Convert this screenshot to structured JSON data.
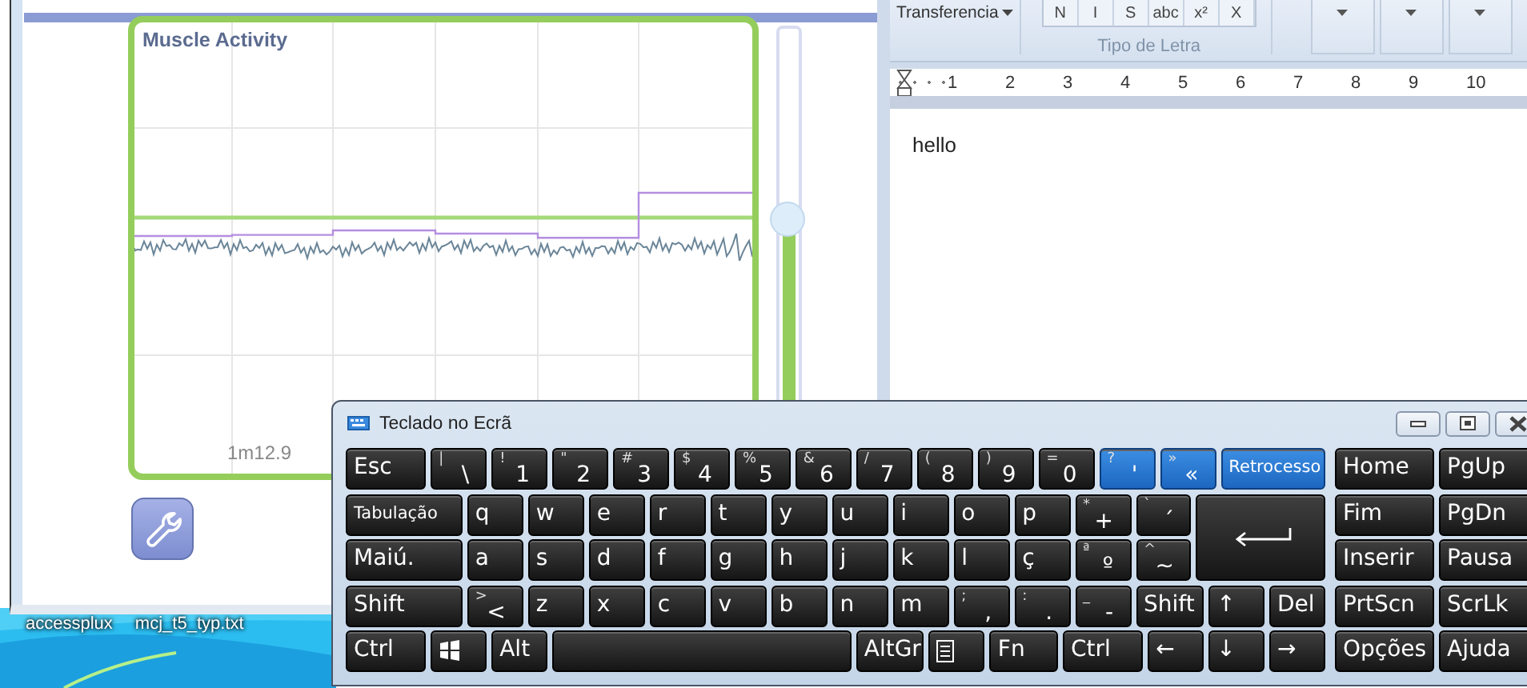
{
  "app_window": {
    "chart": {
      "title": "Muscle Activity",
      "time_label": "1m12.9"
    },
    "slider": {
      "level": 0.6
    }
  },
  "desktop_icons": [
    {
      "label": "accessplux"
    },
    {
      "label": "mcj_t5_typ.txt"
    }
  ],
  "word_window": {
    "clipboard_button": "Transferencia",
    "format_buttons": [
      "N",
      "I",
      "S",
      "abc",
      "x²",
      "X"
    ],
    "font_group_label": "Tipo de Letra",
    "ruler_numbers": [
      "1",
      "2",
      "3",
      "4",
      "5",
      "6",
      "7",
      "8",
      "9",
      "10"
    ],
    "document_text": "hello"
  },
  "keyboard": {
    "title": "Teclado no Ecrã",
    "rows": [
      {
        "keys": [
          {
            "kind": "text",
            "label": "Esc",
            "highlighted": false
          },
          {
            "kind": "dual",
            "shift": "|",
            "label": "\\",
            "highlighted": false
          },
          {
            "kind": "dual",
            "shift": "!",
            "label": "1",
            "highlighted": false
          },
          {
            "kind": "dual",
            "shift": "\"",
            "label": "2",
            "highlighted": false
          },
          {
            "kind": "dual",
            "shift": "#",
            "label": "3",
            "highlighted": false
          },
          {
            "kind": "dual",
            "shift": "$",
            "label": "4",
            "highlighted": false
          },
          {
            "kind": "dual",
            "shift": "%",
            "label": "5",
            "highlighted": false
          },
          {
            "kind": "dual",
            "shift": "&",
            "label": "6",
            "highlighted": false
          },
          {
            "kind": "dual",
            "shift": "/",
            "label": "7",
            "highlighted": false
          },
          {
            "kind": "dual",
            "shift": "(",
            "label": "8",
            "highlighted": false
          },
          {
            "kind": "dual",
            "shift": ")",
            "label": "9",
            "highlighted": false
          },
          {
            "kind": "dual",
            "shift": "=",
            "label": "0",
            "highlighted": false
          },
          {
            "kind": "dual",
            "shift": "?",
            "label": "'",
            "highlighted": true
          },
          {
            "kind": "dual",
            "shift": "»",
            "label": "«",
            "highlighted": true
          },
          {
            "kind": "text",
            "label": "Retrocesso",
            "highlighted": true
          }
        ]
      },
      {
        "keys": [
          {
            "kind": "text",
            "label": "Tabulação",
            "highlighted": false
          },
          {
            "kind": "text",
            "label": "q",
            "highlighted": false
          },
          {
            "kind": "text",
            "label": "w",
            "highlighted": false
          },
          {
            "kind": "text",
            "label": "e",
            "highlighted": false
          },
          {
            "kind": "text",
            "label": "r",
            "highlighted": false
          },
          {
            "kind": "text",
            "label": "t",
            "highlighted": false
          },
          {
            "kind": "text",
            "label": "y",
            "highlighted": false
          },
          {
            "kind": "text",
            "label": "u",
            "highlighted": false
          },
          {
            "kind": "text",
            "label": "i",
            "highlighted": false
          },
          {
            "kind": "text",
            "label": "o",
            "highlighted": false
          },
          {
            "kind": "text",
            "label": "p",
            "highlighted": false
          },
          {
            "kind": "dual",
            "shift": "*",
            "label": "+",
            "highlighted": false
          },
          {
            "kind": "dual",
            "shift": "`",
            "label": "´",
            "highlighted": false
          },
          {
            "kind": "enter",
            "highlighted": false
          }
        ]
      },
      {
        "keys": [
          {
            "kind": "text",
            "label": "Maiú.",
            "highlighted": false
          },
          {
            "kind": "text",
            "label": "a",
            "highlighted": false
          },
          {
            "kind": "text",
            "label": "s",
            "highlighted": false
          },
          {
            "kind": "text",
            "label": "d",
            "highlighted": false
          },
          {
            "kind": "text",
            "label": "f",
            "highlighted": false
          },
          {
            "kind": "text",
            "label": "g",
            "highlighted": false
          },
          {
            "kind": "text",
            "label": "h",
            "highlighted": false
          },
          {
            "kind": "text",
            "label": "j",
            "highlighted": false
          },
          {
            "kind": "text",
            "label": "k",
            "highlighted": false
          },
          {
            "kind": "text",
            "label": "l",
            "highlighted": false
          },
          {
            "kind": "text",
            "label": "ç",
            "highlighted": false
          },
          {
            "kind": "dual",
            "shift": "ª",
            "label": "º",
            "highlighted": false
          },
          {
            "kind": "dual",
            "shift": "^",
            "label": "~",
            "highlighted": false
          }
        ]
      },
      {
        "keys": [
          {
            "kind": "text",
            "label": "Shift",
            "highlighted": false
          },
          {
            "kind": "dual",
            "shift": ">",
            "label": "<",
            "highlighted": false
          },
          {
            "kind": "text",
            "label": "z",
            "highlighted": false
          },
          {
            "kind": "text",
            "label": "x",
            "highlighted": false
          },
          {
            "kind": "text",
            "label": "c",
            "highlighted": false
          },
          {
            "kind": "text",
            "label": "v",
            "highlighted": false
          },
          {
            "kind": "text",
            "label": "b",
            "highlighted": false
          },
          {
            "kind": "text",
            "label": "n",
            "highlighted": false
          },
          {
            "kind": "text",
            "label": "m",
            "highlighted": false
          },
          {
            "kind": "dual",
            "shift": ";",
            "label": ",",
            "highlighted": false
          },
          {
            "kind": "dual",
            "shift": ":",
            "label": ".",
            "highlighted": false
          },
          {
            "kind": "dual",
            "shift": "_",
            "label": "-",
            "highlighted": false
          },
          {
            "kind": "text",
            "label": "Shift",
            "highlighted": false
          },
          {
            "kind": "text",
            "label": "↑",
            "highlighted": false
          },
          {
            "kind": "text",
            "label": "Del",
            "highlighted": false
          }
        ]
      },
      {
        "keys": [
          {
            "kind": "text",
            "label": "Ctrl",
            "highlighted": false
          },
          {
            "kind": "windows",
            "highlighted": false
          },
          {
            "kind": "text",
            "label": "Alt",
            "highlighted": false
          },
          {
            "kind": "space",
            "highlighted": false
          },
          {
            "kind": "text",
            "label": "AltGr",
            "highlighted": false
          },
          {
            "kind": "menu",
            "highlighted": false
          },
          {
            "kind": "text",
            "label": "Fn",
            "highlighted": false
          },
          {
            "kind": "text",
            "label": "Ctrl",
            "highlighted": false
          },
          {
            "kind": "text",
            "label": "←",
            "highlighted": false
          },
          {
            "kind": "text",
            "label": "↓",
            "highlighted": false
          },
          {
            "kind": "text",
            "label": "→",
            "highlighted": false
          }
        ]
      }
    ],
    "nav_keys": [
      "Home",
      "PgUp",
      "Fim",
      "PgDn",
      "Inserir",
      "Pausa",
      "PrtScn",
      "ScrLk",
      "Opções",
      "Ajuda"
    ]
  }
}
